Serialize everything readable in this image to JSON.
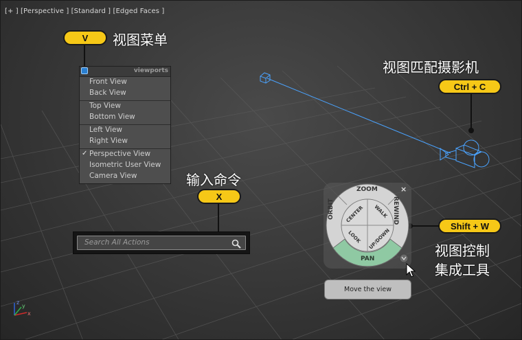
{
  "viewport": {
    "label": "[+ ] [Perspective ] [Standard ] [Edged Faces ]"
  },
  "callouts": {
    "view_menu": {
      "key": "V",
      "text": "视图菜单"
    },
    "match_camera": {
      "key": "Ctrl + C",
      "text": "视图匹配摄影机"
    },
    "input_command": {
      "key": "X",
      "text": "输入命令"
    },
    "view_control": {
      "key": "Shift + W",
      "text_line1": "视图控制",
      "text_line2": "集成工具"
    }
  },
  "viewport_menu": {
    "title": "viewports",
    "groups": [
      [
        {
          "label": "Front View",
          "checked": false
        },
        {
          "label": "Back View",
          "checked": false
        }
      ],
      [
        {
          "label": "Top View",
          "checked": false
        },
        {
          "label": "Bottom View",
          "checked": false
        }
      ],
      [
        {
          "label": "Left View",
          "checked": false
        },
        {
          "label": "Right View",
          "checked": false
        }
      ],
      [
        {
          "label": "Perspective View",
          "checked": true
        },
        {
          "label": "Isometric User View",
          "checked": false
        },
        {
          "label": "Camera View",
          "checked": false
        }
      ]
    ]
  },
  "search": {
    "placeholder": "Search All Actions"
  },
  "steering_wheel": {
    "close": "×",
    "zoom": "ZOOM",
    "orbit": "ORBIT",
    "rewind": "REWIND",
    "pan": "PAN",
    "center": "CENTER",
    "walk": "WALK",
    "look": "LOOK",
    "updown": "UP/DOWN"
  },
  "tooltip": "Move the view",
  "axis": {
    "x": "x",
    "y": "y",
    "z": "z"
  },
  "colors": {
    "accent": "#f6c817",
    "camera": "#4aa3ff",
    "pan_highlight": "#8fc9a3"
  }
}
